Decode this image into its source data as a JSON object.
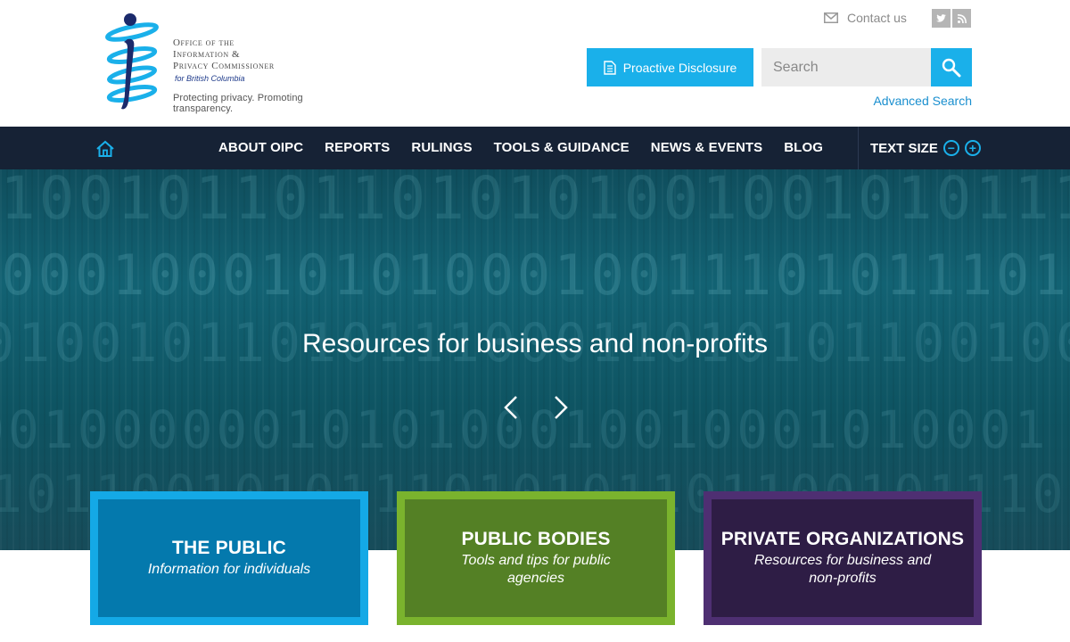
{
  "header": {
    "logo": {
      "line1": "Office of the",
      "line2": "Information &",
      "line3": "Privacy Commissioner",
      "sub": "for British Columbia",
      "tagline": "Protecting privacy. Promoting transparency."
    },
    "contact_label": "Contact us",
    "social": [
      "twitter-icon",
      "rss-icon"
    ],
    "proactive_label": "Proactive Disclosure",
    "search_placeholder": "Search",
    "advanced_search": "Advanced Search"
  },
  "nav": {
    "items": [
      "ABOUT OIPC",
      "REPORTS",
      "RULINGS",
      "TOOLS & GUIDANCE",
      "NEWS & EVENTS",
      "BLOG"
    ],
    "text_size_label": "TEXT SIZE",
    "decrease": "−",
    "increase": "+"
  },
  "hero": {
    "title": "Resources for business and non-profits",
    "rows": [
      "1001011011010101001001010111000",
      "1000100010101000100111010111011",
      "0100101101011100011010101100100",
      "0010000001010100010010001010001",
      "1011001010111010101101100101110"
    ]
  },
  "tiles": [
    {
      "title": "THE PUBLIC",
      "subtitle": "Information for individuals"
    },
    {
      "title": "PUBLIC BODIES",
      "subtitle": "Tools and tips for public agencies"
    },
    {
      "title": "PRIVATE ORGANIZATIONS",
      "subtitle": "Resources for business and non-profits"
    }
  ],
  "colors": {
    "accent": "#1ab0ea",
    "nav_bg": "#162235",
    "tile_public_border": "#14a9e6",
    "tile_public_fill": "#0479ad",
    "tile_bodies_border": "#7ab32d",
    "tile_bodies_fill": "#548025",
    "tile_private_border": "#4e2f72",
    "tile_private_fill": "#2e1d45"
  }
}
